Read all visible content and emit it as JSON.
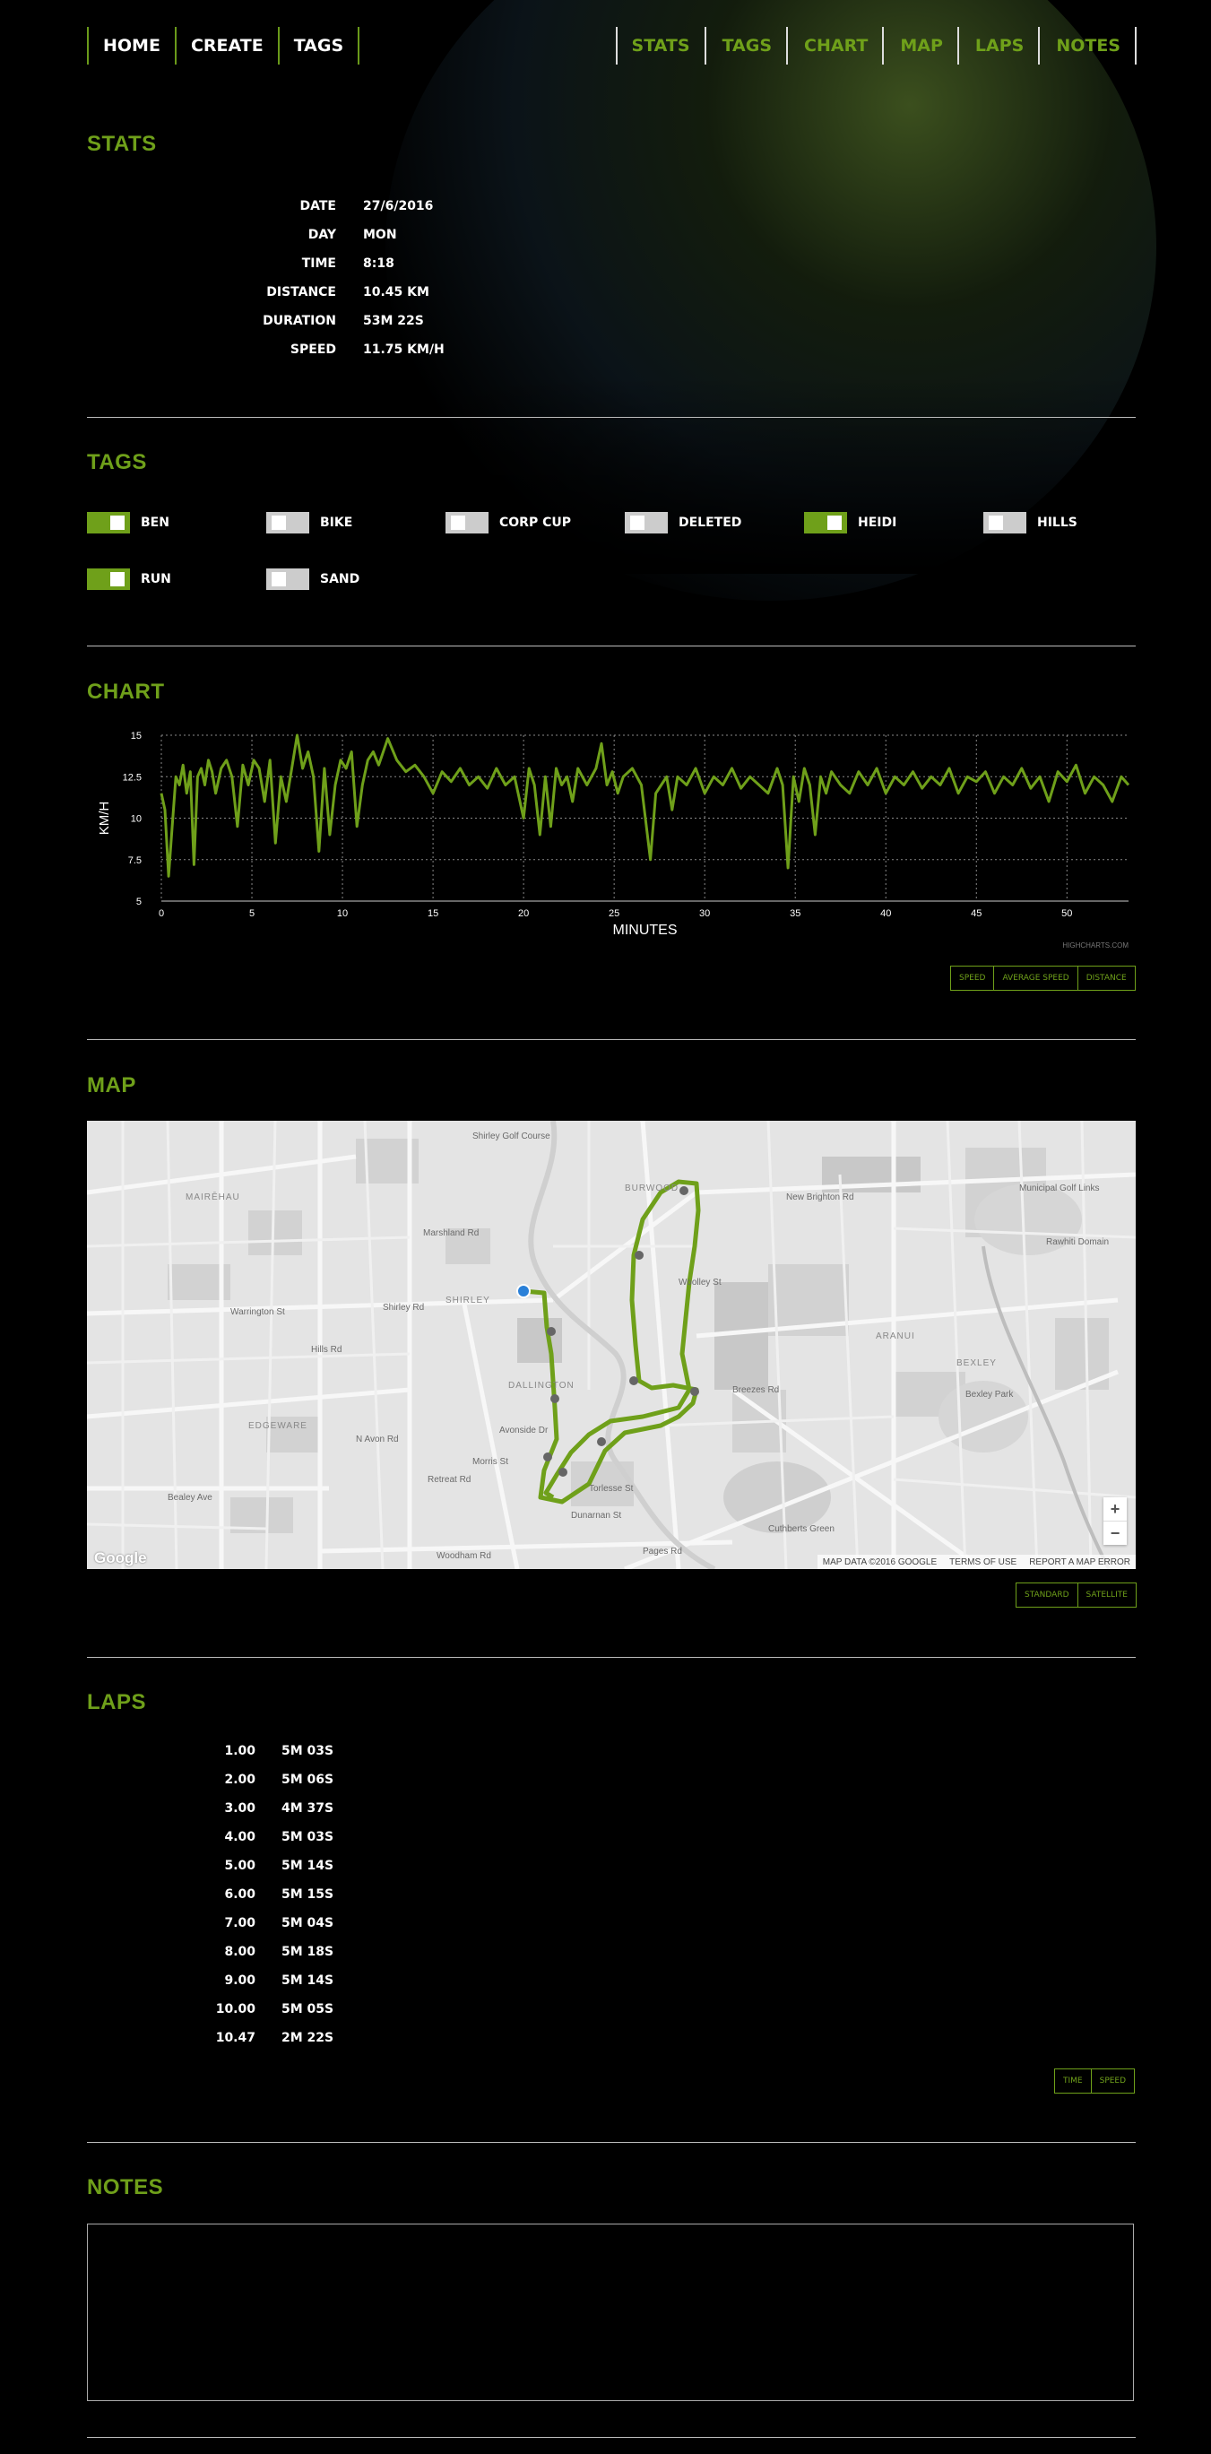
{
  "nav": {
    "left": [
      "HOME",
      "CREATE",
      "TAGS"
    ],
    "right": [
      "STATS",
      "TAGS",
      "CHART",
      "MAP",
      "LAPS",
      "NOTES"
    ]
  },
  "stats": {
    "title": "STATS",
    "rows": [
      {
        "label": "DATE",
        "value": "27/6/2016"
      },
      {
        "label": "DAY",
        "value": "MON"
      },
      {
        "label": "TIME",
        "value": "8:18"
      },
      {
        "label": "DISTANCE",
        "value": "10.45 KM"
      },
      {
        "label": "DURATION",
        "value": "53M 22S"
      },
      {
        "label": "SPEED",
        "value": "11.75 KM/H"
      }
    ]
  },
  "tags": {
    "title": "TAGS",
    "items": [
      {
        "label": "BEN",
        "on": true
      },
      {
        "label": "BIKE",
        "on": false
      },
      {
        "label": "CORP CUP",
        "on": false
      },
      {
        "label": "DELETED",
        "on": false
      },
      {
        "label": "HEIDI",
        "on": true
      },
      {
        "label": "HILLS",
        "on": false
      },
      {
        "label": "RUN",
        "on": true
      },
      {
        "label": "SAND",
        "on": false
      }
    ]
  },
  "chart": {
    "title": "CHART",
    "credit": "HIGHCHARTS.COM",
    "buttons": [
      "SPEED",
      "AVERAGE SPEED",
      "DISTANCE"
    ]
  },
  "chart_data": {
    "type": "line",
    "xlabel": "MINUTES",
    "ylabel": "KM/H",
    "xlim": [
      0,
      53.4
    ],
    "ylim": [
      5,
      15
    ],
    "xticks": [
      0,
      5,
      10,
      15,
      20,
      25,
      30,
      35,
      40,
      45,
      50
    ],
    "yticks": [
      5,
      7.5,
      10,
      12.5,
      15
    ],
    "grid": true,
    "series": [
      {
        "color": "#6fa01a",
        "x": [
          0,
          0.2,
          0.4,
          0.6,
          0.8,
          1.0,
          1.2,
          1.4,
          1.6,
          1.8,
          2.0,
          2.2,
          2.4,
          2.6,
          2.8,
          3.0,
          3.3,
          3.6,
          3.9,
          4.2,
          4.5,
          4.8,
          5.1,
          5.4,
          5.7,
          6.0,
          6.3,
          6.6,
          6.9,
          7.2,
          7.5,
          7.8,
          8.1,
          8.4,
          8.7,
          9.0,
          9.3,
          9.6,
          9.9,
          10.2,
          10.5,
          10.8,
          11.1,
          11.4,
          11.7,
          12.0,
          12.5,
          13.0,
          13.5,
          14.0,
          14.5,
          15.0,
          15.5,
          16.0,
          16.5,
          17.0,
          17.5,
          18.0,
          18.5,
          19.0,
          19.5,
          20.0,
          20.3,
          20.6,
          20.9,
          21.2,
          21.5,
          21.8,
          22.1,
          22.4,
          22.7,
          23.0,
          23.5,
          24.0,
          24.3,
          24.6,
          24.9,
          25.2,
          25.5,
          26.0,
          26.5,
          27.0,
          27.3,
          27.6,
          27.9,
          28.2,
          28.5,
          29.0,
          29.5,
          30.0,
          30.5,
          31.0,
          31.5,
          32.0,
          32.5,
          33.0,
          33.5,
          34.0,
          34.3,
          34.6,
          34.9,
          35.2,
          35.5,
          35.8,
          36.1,
          36.4,
          36.7,
          37.0,
          37.5,
          38.0,
          38.5,
          39.0,
          39.5,
          40.0,
          40.5,
          41.0,
          41.5,
          42.0,
          42.5,
          43.0,
          43.5,
          44.0,
          44.5,
          45.0,
          45.5,
          46.0,
          46.5,
          47.0,
          47.5,
          48.0,
          48.5,
          49.0,
          49.5,
          50.0,
          50.5,
          51.0,
          51.5,
          52.0,
          52.5,
          53.0,
          53.4
        ],
        "values": [
          11.5,
          10.5,
          6.5,
          9.5,
          12.5,
          12.0,
          13.2,
          11.5,
          12.8,
          7.2,
          12.5,
          13.0,
          12.0,
          13.5,
          12.8,
          11.5,
          13.0,
          13.5,
          12.5,
          9.5,
          13.2,
          12.0,
          13.5,
          13.0,
          11.0,
          13.5,
          8.5,
          12.5,
          11.0,
          13.0,
          15.0,
          13.0,
          14.0,
          12.5,
          8.0,
          13.0,
          9.0,
          12.0,
          13.5,
          13.0,
          14.0,
          9.5,
          12.0,
          13.5,
          14.0,
          13.2,
          14.8,
          13.5,
          12.8,
          13.2,
          12.5,
          11.5,
          12.8,
          12.2,
          13.0,
          12.0,
          12.5,
          11.8,
          13.0,
          12.0,
          12.5,
          10.0,
          13.0,
          12.0,
          9.0,
          12.5,
          9.5,
          13.0,
          12.0,
          12.5,
          11.0,
          13.0,
          12.0,
          13.0,
          14.5,
          12.0,
          12.8,
          11.5,
          12.5,
          13.0,
          12.0,
          7.5,
          11.5,
          12.0,
          12.5,
          10.5,
          12.5,
          12.0,
          13.0,
          11.5,
          12.5,
          12.0,
          13.0,
          11.8,
          12.5,
          12.0,
          11.5,
          13.0,
          12.0,
          7.0,
          12.5,
          11.0,
          13.0,
          12.0,
          9.0,
          12.5,
          11.5,
          12.8,
          12.0,
          11.5,
          12.8,
          12.0,
          13.0,
          11.5,
          12.5,
          12.0,
          12.8,
          11.8,
          12.5,
          12.0,
          13.0,
          11.5,
          12.5,
          12.2,
          12.8,
          11.5,
          12.5,
          12.0,
          13.0,
          11.8,
          12.5,
          11.0,
          12.8,
          12.2,
          13.2,
          11.5,
          12.5,
          12.0,
          11.0,
          12.5,
          12.0
        ]
      }
    ]
  },
  "map": {
    "title": "MAP",
    "labels": [
      "MAIRĒHAU",
      "Shirley Golf Course",
      "BURWOOD",
      "Municipal Golf Links",
      "Rawhiti Domain",
      "SHIRLEY",
      "DALLINGTON",
      "EDGEWARE",
      "ARANUI",
      "BEXLEY",
      "Bexley Park",
      "Cuthberts Green",
      "Warrington St",
      "Shirley Rd",
      "New Brighton Rd",
      "Bealey Ave",
      "Woodham Rd",
      "Pages Rd",
      "Breezes Rd",
      "Dunarnan St",
      "Torlesse St",
      "Morris St",
      "N Avon Rd",
      "Retreat Rd",
      "Hills Rd",
      "Marshland Rd",
      "Avonside Dr",
      "Woolley St"
    ],
    "attribution": [
      "MAP DATA ©2016 GOOGLE",
      "TERMS OF USE",
      "REPORT A MAP ERROR"
    ],
    "logo": "Google",
    "zoom_in": "+",
    "zoom_out": "−",
    "buttons": [
      "STANDARD",
      "SATELLITE"
    ]
  },
  "laps": {
    "title": "LAPS",
    "rows": [
      {
        "num": "1.00",
        "time": "5M 03S"
      },
      {
        "num": "2.00",
        "time": "5M 06S"
      },
      {
        "num": "3.00",
        "time": "4M 37S"
      },
      {
        "num": "4.00",
        "time": "5M 03S"
      },
      {
        "num": "5.00",
        "time": "5M 14S"
      },
      {
        "num": "6.00",
        "time": "5M 15S"
      },
      {
        "num": "7.00",
        "time": "5M 04S"
      },
      {
        "num": "8.00",
        "time": "5M 18S"
      },
      {
        "num": "9.00",
        "time": "5M 14S"
      },
      {
        "num": "10.00",
        "time": "5M 05S"
      },
      {
        "num": "10.47",
        "time": "2M 22S"
      }
    ],
    "buttons": [
      "TIME",
      "SPEED"
    ]
  },
  "notes": {
    "title": "NOTES",
    "value": ""
  }
}
